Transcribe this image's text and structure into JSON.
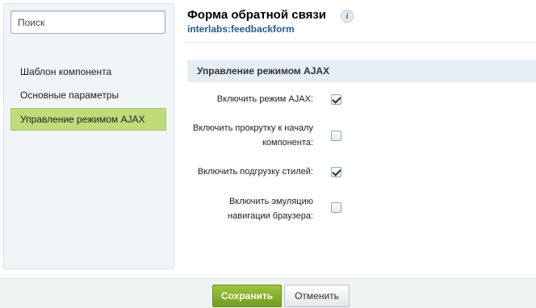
{
  "sidebar": {
    "search_placeholder": "Поиск",
    "items": [
      {
        "label": "Шаблон компонента",
        "active": false
      },
      {
        "label": "Основные параметры",
        "active": false
      },
      {
        "label": "Управление режимом AJAX",
        "active": true
      }
    ]
  },
  "header": {
    "title": "Форма обратной связи",
    "info_icon": "info-icon",
    "component_code": "interlabs:feedbackform"
  },
  "section": {
    "title": "Управление режимом AJAX",
    "rows": [
      {
        "label_lines": [
          "Включить режим AJAX:"
        ],
        "checked": true
      },
      {
        "label_lines": [
          "Включить прокрутку к началу",
          "компонента:"
        ],
        "checked": false
      },
      {
        "label_lines": [
          "Включить подгрузку стилей:"
        ],
        "checked": true
      },
      {
        "label_lines": [
          "Включить эмуляцию",
          "навигации браузера:"
        ],
        "checked": false
      }
    ]
  },
  "footer": {
    "save_label": "Сохранить",
    "cancel_label": "Отменить"
  },
  "colors": {
    "active_item_bg": "#bfdb7a",
    "save_button": "#7fab26",
    "section_header_bg": "#e5eef5",
    "component_code": "#275b8e"
  }
}
